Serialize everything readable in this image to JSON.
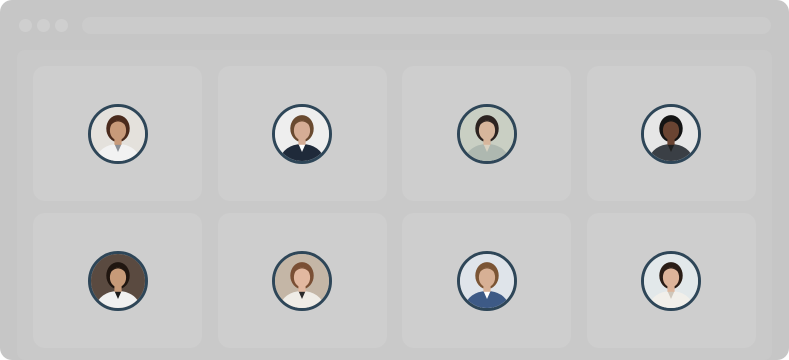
{
  "people": [
    {
      "avatar": "doctor-woman-avatar",
      "bg": "#e4e1dc",
      "skin": "#c89a7a",
      "hair": "#4a2a1c",
      "top": "#f2f2f2",
      "accent": "#8a8f96"
    },
    {
      "avatar": "businessman-avatar",
      "bg": "#eeeeee",
      "skin": "#d6ad95",
      "hair": "#6a4a30",
      "top": "#1f2a3a",
      "accent": "#ffffff"
    },
    {
      "avatar": "woman-avatar",
      "bg": "#c9cfc3",
      "skin": "#d7b69c",
      "hair": "#2c2320",
      "top": "#aeb8b0",
      "accent": "#d9d2c2"
    },
    {
      "avatar": "chef-man-avatar",
      "bg": "#e6e6e6",
      "skin": "#6a4432",
      "hair": "#141414",
      "top": "#3a3f45",
      "accent": "#202020"
    },
    {
      "avatar": "man-suit-avatar",
      "bg": "#5a4a40",
      "skin": "#c79a78",
      "hair": "#201610",
      "top": "#f0f0f0",
      "accent": "#1b1b1b"
    },
    {
      "avatar": "businesswoman-phone-avatar",
      "bg": "#c4b6a6",
      "skin": "#e2b8a0",
      "hair": "#7a4f34",
      "top": "#efece6",
      "accent": "#2a2a2a"
    },
    {
      "avatar": "man-blue-suit-avatar",
      "bg": "#dfe4ea",
      "skin": "#d7b095",
      "hair": "#7b5535",
      "top": "#3d5a86",
      "accent": "#ffffff"
    },
    {
      "avatar": "woman-blazer-avatar",
      "bg": "#e2e8ea",
      "skin": "#ddb49a",
      "hair": "#2a1d16",
      "top": "#f1efea",
      "accent": "#cfc7bb"
    }
  ]
}
